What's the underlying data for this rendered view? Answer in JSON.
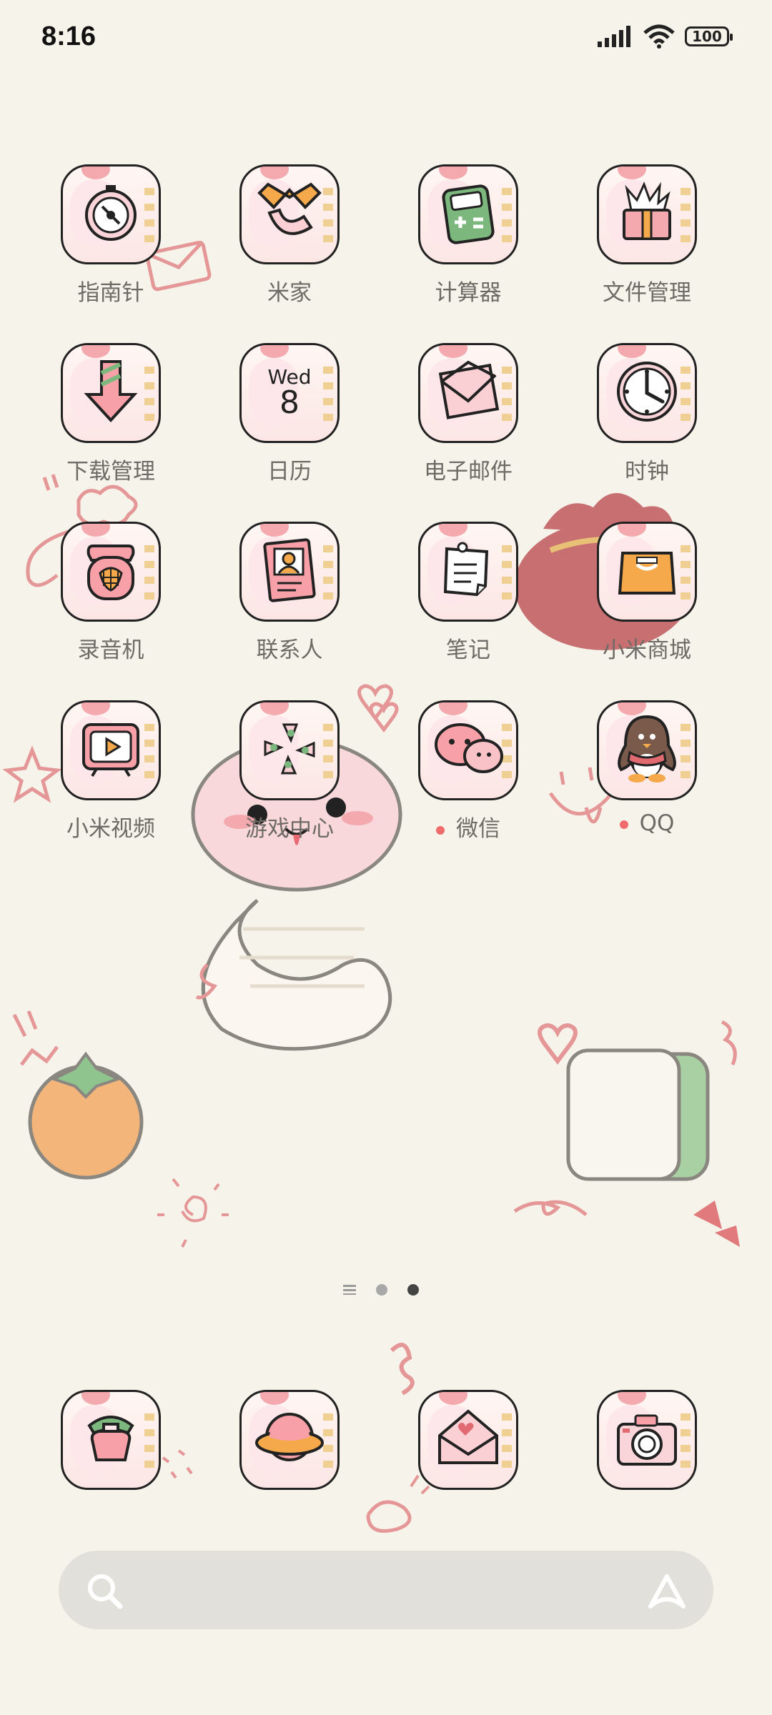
{
  "status_bar": {
    "time": "8:16",
    "battery": "100"
  },
  "apps": [
    {
      "label": "指南针",
      "icon": "compass-icon"
    },
    {
      "label": "米家",
      "icon": "mijia-icon"
    },
    {
      "label": "计算器",
      "icon": "calculator-icon"
    },
    {
      "label": "文件管理",
      "icon": "file-manager-icon"
    },
    {
      "label": "下载管理",
      "icon": "download-icon"
    },
    {
      "label": "日历",
      "icon": "calendar-icon",
      "day": "Wed",
      "date": "8"
    },
    {
      "label": "电子邮件",
      "icon": "mail-icon"
    },
    {
      "label": "时钟",
      "icon": "clock-icon"
    },
    {
      "label": "录音机",
      "icon": "recorder-icon"
    },
    {
      "label": "联系人",
      "icon": "contacts-icon"
    },
    {
      "label": "笔记",
      "icon": "notes-icon"
    },
    {
      "label": "小米商城",
      "icon": "mi-store-icon"
    },
    {
      "label": "小米视频",
      "icon": "mi-video-icon"
    },
    {
      "label": "游戏中心",
      "icon": "game-center-icon"
    },
    {
      "label": "微信",
      "icon": "wechat-icon",
      "notification": true
    },
    {
      "label": "QQ",
      "icon": "qq-icon",
      "notification": true
    }
  ],
  "dock": [
    {
      "icon": "phone-icon"
    },
    {
      "icon": "browser-icon"
    },
    {
      "icon": "messages-icon"
    },
    {
      "icon": "camera-icon"
    }
  ],
  "pager": {
    "pages": 2,
    "active": 2
  },
  "colors": {
    "background": "#f6f3ea",
    "accent_pink": "#f4a9ae",
    "text": "#6e6a66"
  }
}
